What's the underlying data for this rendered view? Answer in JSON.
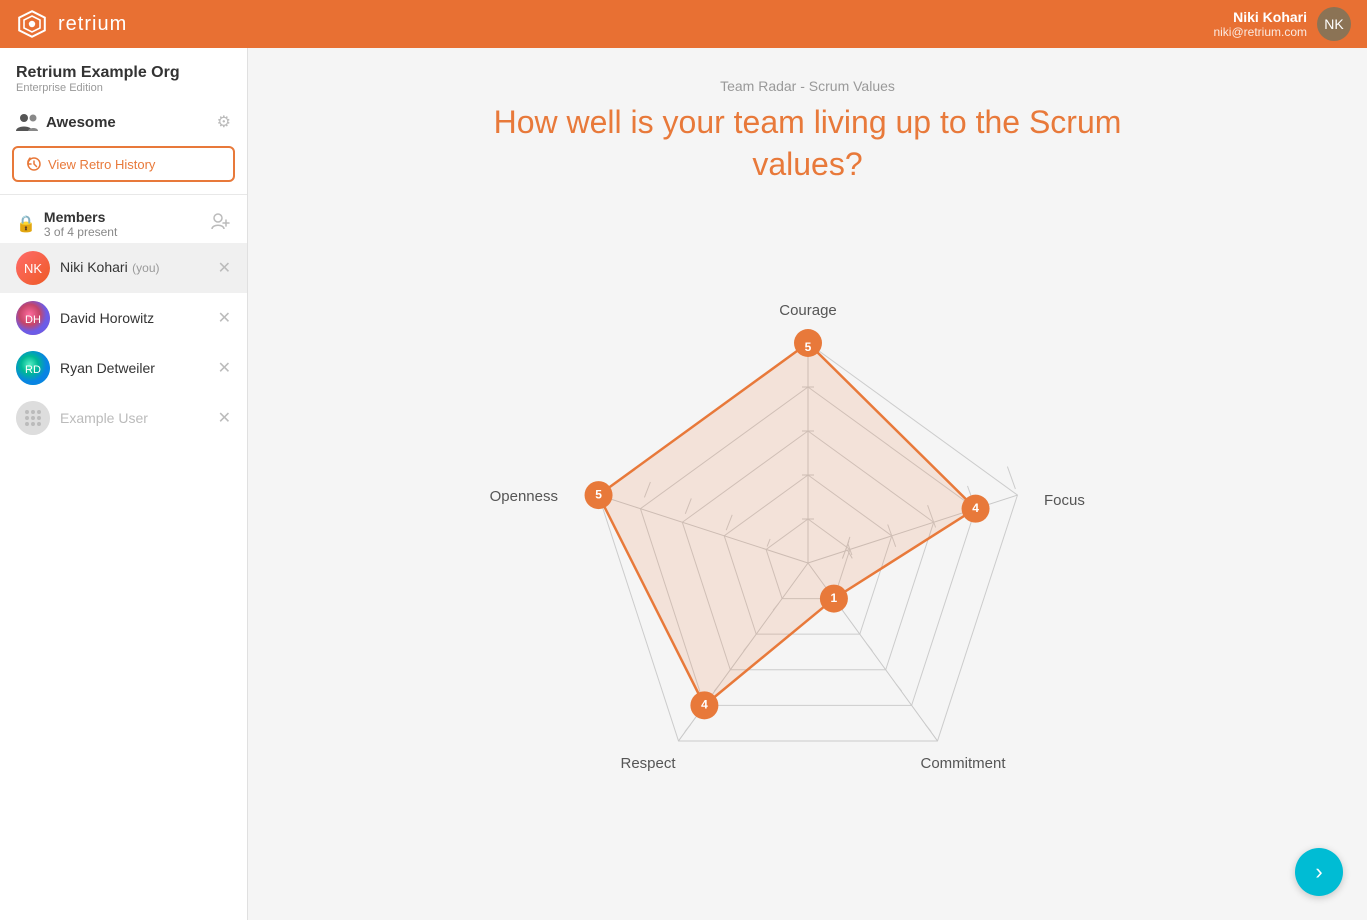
{
  "header": {
    "logo_text": "retrium",
    "user_name": "Niki Kohari",
    "user_email": "niki@retrium.com"
  },
  "sidebar": {
    "org_name": "Retrium Example Org",
    "org_edition": "Enterprise Edition",
    "team_name": "Awesome",
    "view_retro_label": "View Retro History",
    "members_label": "Members",
    "members_count": "3 of 4 present",
    "members": [
      {
        "name": "Niki Kohari",
        "you": true,
        "present": true,
        "av_class": "av-niki"
      },
      {
        "name": "David Horowitz",
        "you": false,
        "present": true,
        "av_class": "av-david"
      },
      {
        "name": "Ryan Detweiler",
        "you": false,
        "present": true,
        "av_class": "av-ryan"
      },
      {
        "name": "Example User",
        "you": false,
        "present": false,
        "av_class": "av-example"
      }
    ]
  },
  "main": {
    "subtitle": "Team Radar - Scrum Values",
    "title": "How well is your team living up to the Scrum values?",
    "radar": {
      "axes": [
        {
          "label": "Courage",
          "value": 5,
          "angle": -90
        },
        {
          "label": "Focus",
          "value": 4,
          "angle": -18
        },
        {
          "label": "Commitment",
          "value": 1,
          "angle": 54
        },
        {
          "label": "Respect",
          "value": 4,
          "angle": 126
        },
        {
          "label": "Openness",
          "value": 5,
          "angle": 198
        }
      ],
      "max_value": 5
    }
  }
}
